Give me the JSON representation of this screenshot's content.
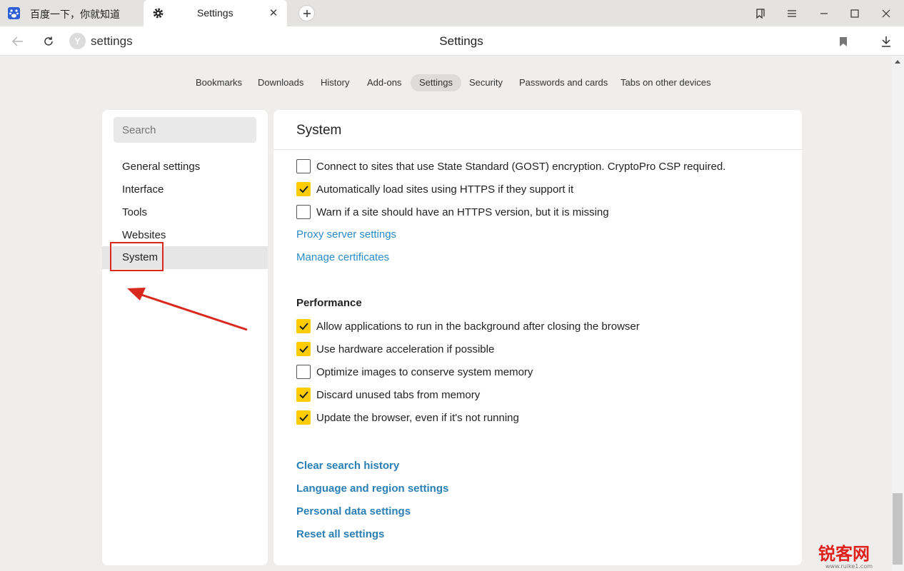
{
  "tabs": [
    {
      "title": "百度一下，你就知道",
      "active": false
    },
    {
      "title": "Settings",
      "active": true
    }
  ],
  "address": {
    "text": "settings",
    "page_title": "Settings"
  },
  "topnav": [
    "Bookmarks",
    "Downloads",
    "History",
    "Add-ons",
    "Settings",
    "Security",
    "Passwords and cards",
    "Tabs on other devices"
  ],
  "topnav_active": "Settings",
  "sidebar": {
    "search_placeholder": "Search",
    "items": [
      "General settings",
      "Interface",
      "Tools",
      "Websites",
      "System"
    ],
    "active": "System"
  },
  "main": {
    "title": "System",
    "checkboxes_top": [
      {
        "label": "Connect to sites that use State Standard (GOST) encryption. CryptoPro CSP required.",
        "checked": false
      },
      {
        "label": "Automatically load sites using HTTPS if they support it",
        "checked": true
      },
      {
        "label": "Warn if a site should have an HTTPS version, but it is missing",
        "checked": false
      }
    ],
    "links_top": [
      "Proxy server settings",
      "Manage certificates"
    ],
    "performance": {
      "title": "Performance",
      "checkboxes": [
        {
          "label": "Allow applications to run in the background after closing the browser",
          "checked": true
        },
        {
          "label": "Use hardware acceleration if possible",
          "checked": true
        },
        {
          "label": "Optimize images to conserve system memory",
          "checked": false
        },
        {
          "label": "Discard unused tabs from memory",
          "checked": true
        },
        {
          "label": "Update the browser, even if it's not running",
          "checked": true
        }
      ]
    },
    "links_bottom": [
      "Clear search history",
      "Language and region settings",
      "Personal data settings",
      "Reset all settings"
    ]
  },
  "colors": {
    "accent_check": "#ffcc00",
    "link": "#2a8bc9",
    "highlight": "#d9281e"
  },
  "watermark": {
    "text": "锐客网",
    "sub": "www.ruike1.com"
  }
}
